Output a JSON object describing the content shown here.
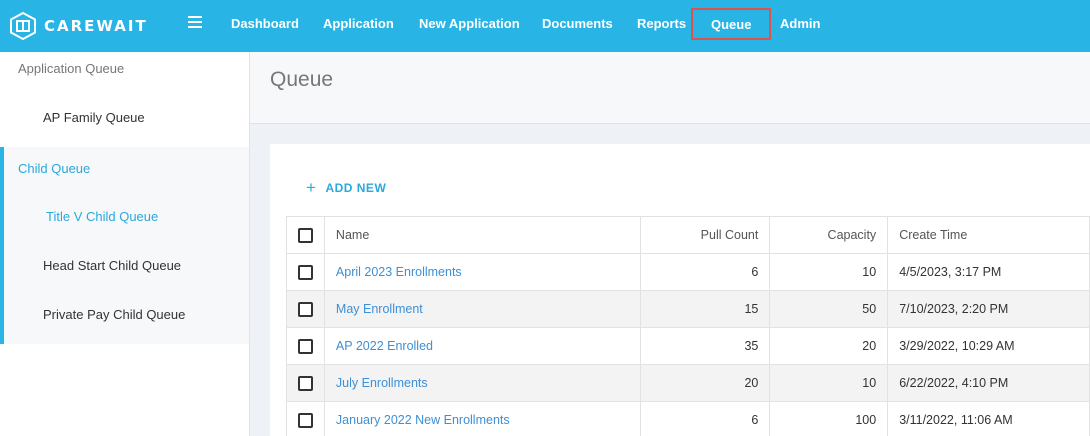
{
  "brand": {
    "name": "CAREWAIT"
  },
  "nav": {
    "items": [
      {
        "label": "Dashboard"
      },
      {
        "label": "Application"
      },
      {
        "label": "New Application"
      },
      {
        "label": "Documents"
      },
      {
        "label": "Reports"
      },
      {
        "label": "Queue"
      },
      {
        "label": "Admin"
      }
    ],
    "active": "Queue"
  },
  "sidebar": {
    "group1": "Application Queue",
    "group1_items": [
      "AP Family Queue"
    ],
    "group2": "Child Queue",
    "group2_items": [
      "Title V Child Queue",
      "Head Start Child Queue",
      "Private Pay Child Queue"
    ]
  },
  "page": {
    "title": "Queue",
    "add_new": "ADD NEW"
  },
  "table": {
    "headers": [
      "Name",
      "Pull Count",
      "Capacity",
      "Create Time"
    ],
    "rows": [
      {
        "name": "April 2023 Enrollments",
        "pull_count": "6",
        "capacity": "10",
        "create_time": "4/5/2023, 3:17 PM"
      },
      {
        "name": "May Enrollment",
        "pull_count": "15",
        "capacity": "50",
        "create_time": "7/10/2023, 2:20 PM"
      },
      {
        "name": "AP 2022 Enrolled",
        "pull_count": "35",
        "capacity": "20",
        "create_time": "3/29/2022, 10:29 AM"
      },
      {
        "name": "July Enrollments",
        "pull_count": "20",
        "capacity": "10",
        "create_time": "6/22/2022, 4:10 PM"
      },
      {
        "name": "January 2022 New Enrollments",
        "pull_count": "6",
        "capacity": "100",
        "create_time": "3/11/2022, 11:06 AM"
      }
    ]
  },
  "colors": {
    "accent": "#29b4e6",
    "highlight_border": "#d9534f",
    "link": "#3d8fd6"
  }
}
